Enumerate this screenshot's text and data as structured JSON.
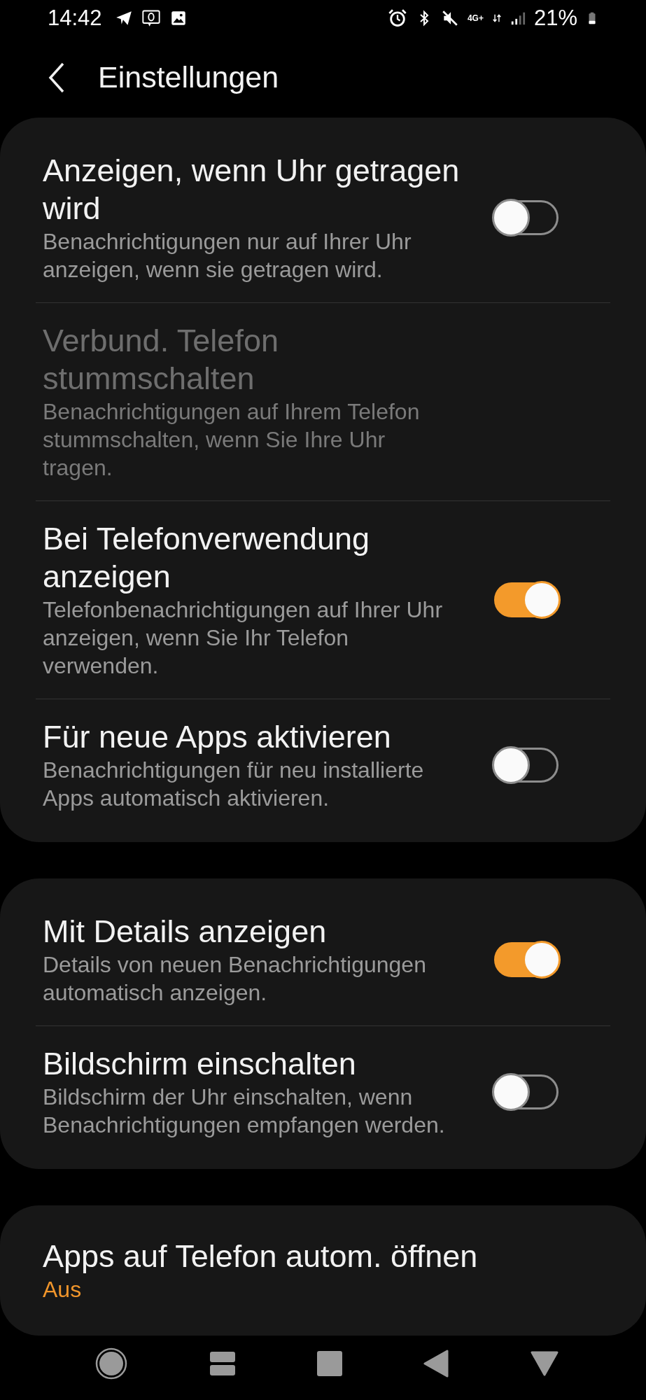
{
  "status_bar": {
    "time": "14:42",
    "network": "4G+",
    "battery": "21%"
  },
  "header": {
    "title": "Einstellungen"
  },
  "groups": [
    {
      "items": [
        {
          "kind": "toggle",
          "title": "Anzeigen, wenn Uhr getragen wird",
          "subtitle": "Benachrichtigungen nur auf Ihrer Uhr anzeigen, wenn sie getragen wird.",
          "on": false,
          "disabled": false
        },
        {
          "kind": "text",
          "title": "Verbund. Telefon stummschalten",
          "subtitle": "Benachrichtigungen auf Ihrem Telefon stummschalten, wenn Sie Ihre Uhr tragen.",
          "disabled": true
        },
        {
          "kind": "toggle",
          "title": "Bei Telefonverwendung anzeigen",
          "subtitle": "Telefonbenachrichtigungen auf Ihrer Uhr anzeigen, wenn Sie Ihr Telefon verwenden.",
          "on": true,
          "disabled": false
        },
        {
          "kind": "toggle",
          "title": "Für neue Apps aktivieren",
          "subtitle": "Benachrichtigungen für neu installierte Apps automatisch aktivieren.",
          "on": false,
          "disabled": false
        }
      ]
    },
    {
      "items": [
        {
          "kind": "toggle",
          "title": "Mit Details anzeigen",
          "subtitle": "Details von neuen Benachrichtigungen automatisch anzeigen.",
          "on": true,
          "disabled": false
        },
        {
          "kind": "toggle",
          "title": "Bildschirm einschalten",
          "subtitle": "Bildschirm der Uhr einschalten, wenn Benachrichtigungen empfangen werden.",
          "on": false,
          "disabled": false
        }
      ]
    },
    {
      "items": [
        {
          "kind": "value",
          "title": "Apps auf Telefon autom. öffnen",
          "value": "Aus",
          "disabled": false
        }
      ]
    }
  ]
}
